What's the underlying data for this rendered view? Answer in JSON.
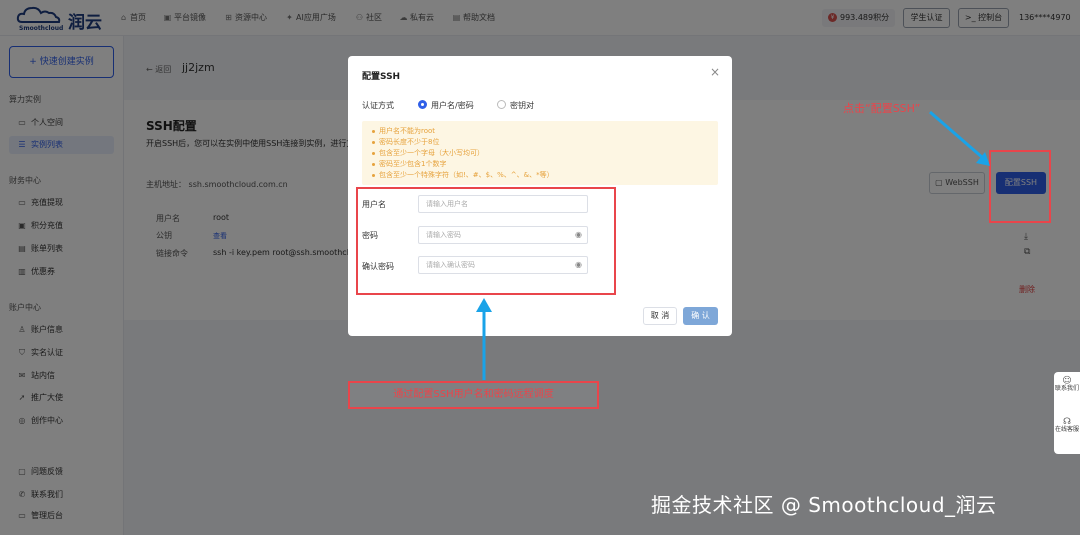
{
  "brand": {
    "name_cn": "润云",
    "name_en": "Smoothcloud"
  },
  "nav": [
    {
      "label": "首页",
      "icon": "home-icon",
      "glyph": "⌂"
    },
    {
      "label": "平台镜像",
      "icon": "image-icon",
      "glyph": "▣"
    },
    {
      "label": "资源中心",
      "icon": "grid-icon",
      "glyph": "⊞"
    },
    {
      "label": "AI应用广场",
      "icon": "ai-icon",
      "glyph": "✦"
    },
    {
      "label": "社区",
      "icon": "community-icon",
      "glyph": "⚇"
    },
    {
      "label": "私有云",
      "icon": "private-cloud-icon",
      "glyph": "☁"
    },
    {
      "label": "帮助文档",
      "icon": "doc-icon",
      "glyph": "▤"
    }
  ],
  "header": {
    "points": "993.489积分",
    "student_auth": "学生认证",
    "console": "控制台",
    "console_glyph": ">_",
    "phone": "136****4970"
  },
  "sidebar": {
    "quick_create": "+ 快速创建实例",
    "sections": [
      {
        "title": "算力实例",
        "items": [
          {
            "label": "个人空间",
            "icon": "folder-icon",
            "glyph": "▭"
          },
          {
            "label": "实例列表",
            "icon": "list-icon",
            "glyph": "☰",
            "active": true
          }
        ]
      },
      {
        "title": "财务中心",
        "items": [
          {
            "label": "充值提现",
            "icon": "wallet-icon",
            "glyph": "▭"
          },
          {
            "label": "积分充值",
            "icon": "points-icon",
            "glyph": "▣"
          },
          {
            "label": "账单列表",
            "icon": "bill-icon",
            "glyph": "▤"
          },
          {
            "label": "优惠券",
            "icon": "coupon-icon",
            "glyph": "▥"
          }
        ]
      },
      {
        "title": "账户中心",
        "items": [
          {
            "label": "账户信息",
            "icon": "user-icon",
            "glyph": "♙"
          },
          {
            "label": "实名认证",
            "icon": "shield-icon",
            "glyph": "⛉"
          },
          {
            "label": "站内信",
            "icon": "mail-icon",
            "glyph": "✉"
          },
          {
            "label": "推广大使",
            "icon": "rocket-icon",
            "glyph": "➚"
          },
          {
            "label": "创作中心",
            "icon": "palette-icon",
            "glyph": "◎"
          }
        ]
      },
      {
        "title": "",
        "items": [
          {
            "label": "问题反馈",
            "icon": "feedback-icon",
            "glyph": "▢"
          },
          {
            "label": "联系我们",
            "icon": "phone-icon",
            "glyph": "✆"
          },
          {
            "label": "管理后台",
            "icon": "admin-icon",
            "glyph": "▭"
          }
        ]
      }
    ]
  },
  "main": {
    "back": "← 返回",
    "instance_name": "jj2jzm",
    "ssh_title": "SSH配置",
    "ssh_desc": "开启SSH后，您可以在实例中使用SSH连接到实例，进行文件",
    "host": "主机地址：  ssh.smoothcloud.com.cn",
    "rows": [
      {
        "label": "用户名",
        "value": "root"
      },
      {
        "label": "公钥",
        "value": "查看"
      },
      {
        "label": "链接命令",
        "value": "ssh -i key.pem root@ssh.smoothcloud."
      }
    ],
    "webssh": "▢ WebSSH",
    "config_ssh": "配置SSH",
    "download_glyph": "⤓",
    "copy_glyph": "⧉",
    "delete": "删除"
  },
  "modal": {
    "title": "配置SSH",
    "close": "×",
    "auth_label": "认证方式",
    "auth_options": [
      {
        "label": "用户名/密码",
        "selected": true
      },
      {
        "label": "密钥对",
        "selected": false
      }
    ],
    "tips": [
      "用户名不能为root",
      "密码长度不少于8位",
      "包含至少一个字母（大小写均可）",
      "密码至少包含1个数字",
      "包含至少一个特殊字符（如!、#、$、%、^、&、*等）"
    ],
    "fields": [
      {
        "label": "用户名",
        "placeholder": "请输入用户名",
        "password": false
      },
      {
        "label": "密码",
        "placeholder": "请输入密码",
        "password": true
      },
      {
        "label": "确认密码",
        "placeholder": "请输入确认密码",
        "password": true
      }
    ],
    "eye_glyph": "◉",
    "cancel": "取 消",
    "confirm": "确 认"
  },
  "annotations": {
    "top": "点击“配置SSH”",
    "bottom": "通过配置SSH用户名和密码远程调度"
  },
  "float": [
    {
      "label": "联系我们",
      "icon": "contact-icon",
      "glyph": "☺"
    },
    {
      "label": "在线客服",
      "icon": "headset-icon",
      "glyph": "☊"
    }
  ],
  "watermark": "掘金技术社区 @ Smoothcloud_润云",
  "colors": {
    "accent": "#2f5fe8",
    "annotation": "#e9454b",
    "tip": "#e6a23c",
    "arrow": "#1aa3e8"
  }
}
